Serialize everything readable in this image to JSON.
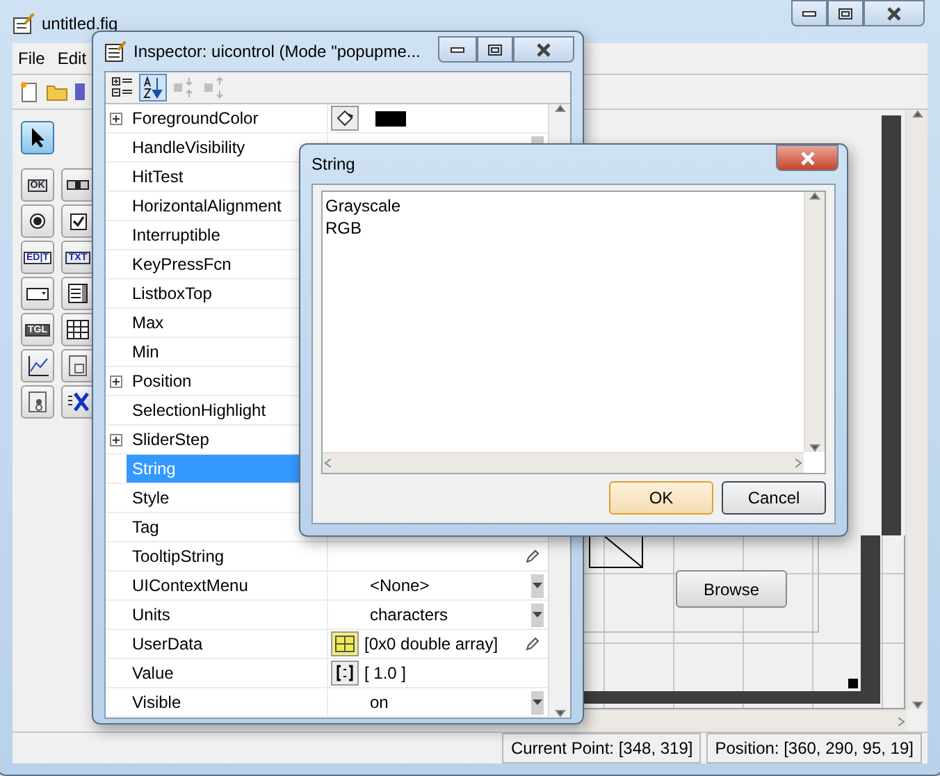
{
  "main_window": {
    "title": "untitled.fig",
    "menu": [
      {
        "label": "File"
      },
      {
        "label": "Edit"
      }
    ],
    "toolbar": [
      {
        "kind": "new"
      },
      {
        "kind": "open"
      },
      {
        "kind": "save"
      }
    ],
    "palette": [
      {
        "kind": "pointer",
        "selected": true
      },
      {
        "kind": "push",
        "label": "OK",
        "selected": false
      },
      {
        "kind": "slider",
        "selected": false
      },
      {
        "kind": "radio",
        "selected": false
      },
      {
        "kind": "check",
        "selected": false
      },
      {
        "kind": "edit",
        "label": "ED|T",
        "selected": false
      },
      {
        "kind": "text",
        "label": "TXT",
        "selected": false
      },
      {
        "kind": "popup",
        "selected": false
      },
      {
        "kind": "listbox",
        "selected": false
      },
      {
        "kind": "toggle",
        "label": "TGL",
        "selected": false
      },
      {
        "kind": "table",
        "selected": false
      },
      {
        "kind": "axes",
        "selected": false
      },
      {
        "kind": "panel",
        "selected": false
      },
      {
        "kind": "group",
        "selected": false
      },
      {
        "kind": "activex",
        "selected": false
      }
    ],
    "canvas": {
      "button": "Browse"
    },
    "status_bar": [
      "Current Point:  [348, 319]",
      "Position: [360, 290, 95, 19]"
    ]
  },
  "inspector": {
    "title": "Inspector:  uicontrol (Mode \"popupme...",
    "toolbar": [
      {
        "kind": "categorized",
        "selected": false,
        "disabled": false
      },
      {
        "kind": "alphabetical",
        "selected": true,
        "disabled": false
      },
      {
        "kind": "collapse",
        "selected": false,
        "disabled": true
      },
      {
        "kind": "expand",
        "selected": false,
        "disabled": true
      }
    ],
    "properties": [
      {
        "name": "ForegroundColor",
        "expandable": true,
        "selected": false,
        "value": {
          "kind": "color",
          "color": "#000000"
        }
      },
      {
        "name": "HandleVisibility",
        "expandable": false,
        "selected": false,
        "value": {
          "kind": "dropdown"
        }
      },
      {
        "name": "HitTest",
        "expandable": false,
        "selected": false
      },
      {
        "name": "HorizontalAlignment",
        "expandable": false,
        "selected": false
      },
      {
        "name": "Interruptible",
        "expandable": false,
        "selected": false
      },
      {
        "name": "KeyPressFcn",
        "expandable": false,
        "selected": false
      },
      {
        "name": "ListboxTop",
        "expandable": false,
        "selected": false
      },
      {
        "name": "Max",
        "expandable": false,
        "selected": false
      },
      {
        "name": "Min",
        "expandable": false,
        "selected": false
      },
      {
        "name": "Position",
        "expandable": true,
        "selected": false
      },
      {
        "name": "SelectionHighlight",
        "expandable": false,
        "selected": false
      },
      {
        "name": "SliderStep",
        "expandable": true,
        "selected": false
      },
      {
        "name": "String",
        "expandable": false,
        "selected": true
      },
      {
        "name": "Style",
        "expandable": false,
        "selected": false
      },
      {
        "name": "Tag",
        "expandable": false,
        "selected": false
      },
      {
        "name": "TooltipString",
        "expandable": false,
        "selected": false,
        "value": {
          "kind": "editable"
        }
      },
      {
        "name": "UIContextMenu",
        "expandable": false,
        "selected": false,
        "value": {
          "kind": "dropdown",
          "text": "<None>"
        }
      },
      {
        "name": "Units",
        "expandable": false,
        "selected": false,
        "value": {
          "kind": "dropdown",
          "text": "characters"
        }
      },
      {
        "name": "UserData",
        "expandable": false,
        "selected": false,
        "value": {
          "kind": "matrix",
          "text": "[0x0  double array]"
        }
      },
      {
        "name": "Value",
        "expandable": false,
        "selected": false,
        "value": {
          "kind": "vector",
          "text": "[ 1.0 ]"
        }
      },
      {
        "name": "Visible",
        "expandable": false,
        "selected": false,
        "value": {
          "kind": "dropdown",
          "text": "on"
        }
      }
    ]
  },
  "dialog": {
    "title": "String",
    "lines": [
      "Grayscale",
      "RGB"
    ],
    "buttons": [
      {
        "label": "OK",
        "default": true
      },
      {
        "label": "Cancel",
        "default": false
      }
    ]
  }
}
